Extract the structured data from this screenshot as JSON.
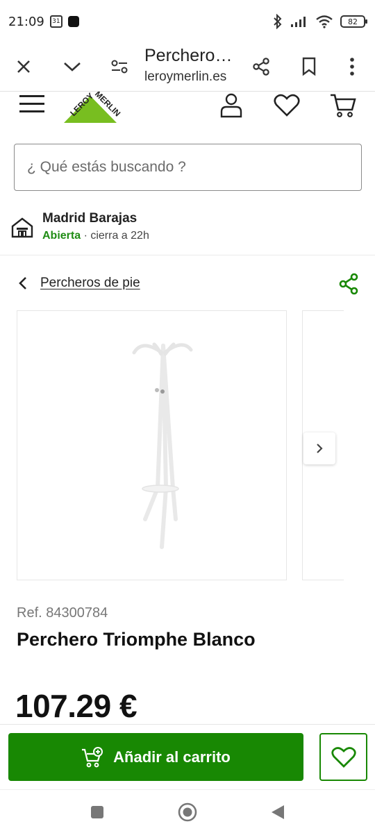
{
  "status_bar": {
    "time": "21:09",
    "calendar_day": "31",
    "battery_level": "82",
    "icons": [
      "bluetooth-icon",
      "signal-icon",
      "wifi-icon",
      "battery-icon"
    ]
  },
  "browser": {
    "page_title": "Perchero…",
    "domain": "leroymerlin.es",
    "icons": [
      "close-icon",
      "chevron-down-icon",
      "tune-icon",
      "share-icon",
      "bookmark-icon",
      "more-vert-icon"
    ]
  },
  "site_header": {
    "logo_text": "LEROY MERLIN",
    "icons": [
      "menu-icon",
      "account-icon",
      "heart-icon",
      "cart-icon"
    ]
  },
  "search": {
    "placeholder": "¿ Qué estás buscando ?"
  },
  "store": {
    "name": "Madrid Barajas",
    "status": "Abierta",
    "separator": " · ",
    "hours": "cierra a 22h"
  },
  "breadcrumb": {
    "label": "Percheros de pie"
  },
  "product": {
    "ref": "Ref. 84300784",
    "name": "Perchero Triomphe Blanco",
    "price": "107.29 €"
  },
  "actions": {
    "add_to_cart": "Añadir al carrito"
  },
  "colors": {
    "brand_green": "#188803",
    "open_green": "#1f8c14",
    "logo_green": "#78be20"
  }
}
